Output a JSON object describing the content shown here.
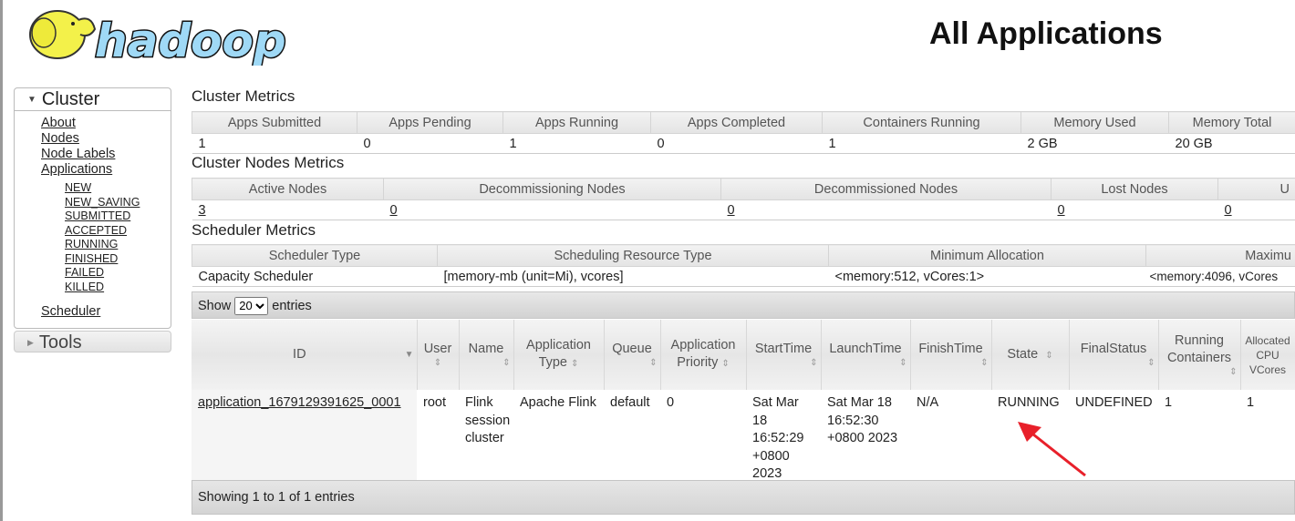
{
  "header": {
    "logo_text": "hadoop",
    "title": "All Applications"
  },
  "sidebar": {
    "cluster_label": "Cluster",
    "items": [
      "About",
      "Nodes",
      "Node Labels",
      "Applications"
    ],
    "app_states": [
      "NEW",
      "NEW_SAVING",
      "SUBMITTED",
      "ACCEPTED",
      "RUNNING",
      "FINISHED",
      "FAILED",
      "KILLED"
    ],
    "scheduler": "Scheduler",
    "tools_label": "Tools"
  },
  "cluster_metrics": {
    "title": "Cluster Metrics",
    "headers": [
      "Apps Submitted",
      "Apps Pending",
      "Apps Running",
      "Apps Completed",
      "Containers Running",
      "Memory Used",
      "Memory Total"
    ],
    "values": [
      "1",
      "0",
      "1",
      "0",
      "1",
      "2 GB",
      "20 GB"
    ]
  },
  "nodes_metrics": {
    "title": "Cluster Nodes Metrics",
    "headers": [
      "Active Nodes",
      "Decommissioning Nodes",
      "Decommissioned Nodes",
      "Lost Nodes",
      "U"
    ],
    "values": [
      "3",
      "0",
      "0",
      "0",
      "0"
    ]
  },
  "scheduler_metrics": {
    "title": "Scheduler Metrics",
    "headers": [
      "Scheduler Type",
      "Scheduling Resource Type",
      "Minimum Allocation",
      "Maximu"
    ],
    "values": [
      "Capacity Scheduler",
      "[memory-mb (unit=Mi), vcores]",
      "<memory:512, vCores:1>",
      "<memory:4096, vCores"
    ]
  },
  "apps_table": {
    "show_label": "Show",
    "entries_label": "entries",
    "page_size": "20",
    "headers": [
      "ID",
      "User",
      "Name",
      "Application Type",
      "Queue",
      "Application Priority",
      "StartTime",
      "LaunchTime",
      "FinishTime",
      "State",
      "FinalStatus",
      "Running Containers",
      "Allocated CPU VCores"
    ],
    "rows": [
      [
        "application_1679129391625_0001",
        "root",
        "Flink session cluster",
        "Apache Flink",
        "default",
        "0",
        "Sat Mar 18 16:52:29 +0800 2023",
        "Sat Mar 18 16:52:30 +0800 2023",
        "N/A",
        "RUNNING",
        "UNDEFINED",
        "1",
        "1"
      ]
    ],
    "footer": "Showing 1 to 1 of 1 entries"
  },
  "annotation": {
    "arrow_color": "#e8202a"
  }
}
